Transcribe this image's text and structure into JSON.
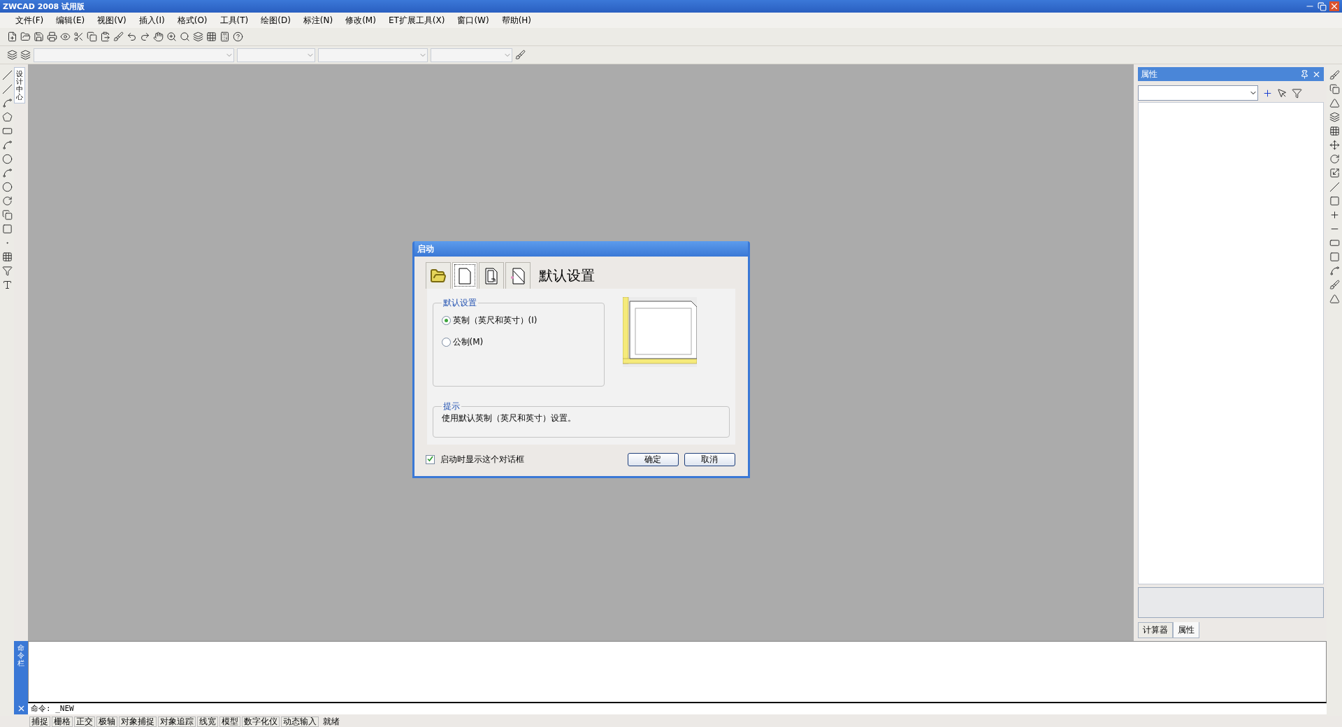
{
  "window": {
    "title": "ZWCAD 2008 试用版"
  },
  "menu": [
    "文件(F)",
    "编辑(E)",
    "视图(V)",
    "插入(I)",
    "格式(O)",
    "工具(T)",
    "绘图(D)",
    "标注(N)",
    "修改(M)",
    "ET扩展工具(X)",
    "窗口(W)",
    "帮助(H)"
  ],
  "left_tab": {
    "label": "设计中心"
  },
  "properties_panel": {
    "title": "属性",
    "tabs": [
      {
        "label": "计算器",
        "selected": false
      },
      {
        "label": "属性",
        "selected": true
      }
    ]
  },
  "dialog": {
    "title": "启动",
    "tabs": [
      {
        "kind": "open",
        "selected": false
      },
      {
        "kind": "default",
        "selected": true
      },
      {
        "kind": "template",
        "selected": false
      },
      {
        "kind": "wizard",
        "selected": false
      }
    ],
    "heading": "默认设置",
    "group_title": "默认设置",
    "options": [
      {
        "label": "英制（英尺和英寸）(I)",
        "selected": true
      },
      {
        "label": "公制(M)",
        "selected": false
      }
    ],
    "hint_title": "提示",
    "hint": "使用默认英制（英尺和英寸）设置。",
    "show_on_startup": {
      "label": "启动时显示这个对话框",
      "checked": true
    },
    "buttons": [
      "确定",
      "取消"
    ]
  },
  "command_bar": {
    "label": "命令栏",
    "prompt": "命令: _NEW"
  },
  "status_bar": {
    "buttons": [
      "捕捉",
      "栅格",
      "正交",
      "极轴",
      "对象捕捉",
      "对象追踪",
      "线宽",
      "模型",
      "数字化仪",
      "动态输入"
    ],
    "status": "就绪"
  }
}
